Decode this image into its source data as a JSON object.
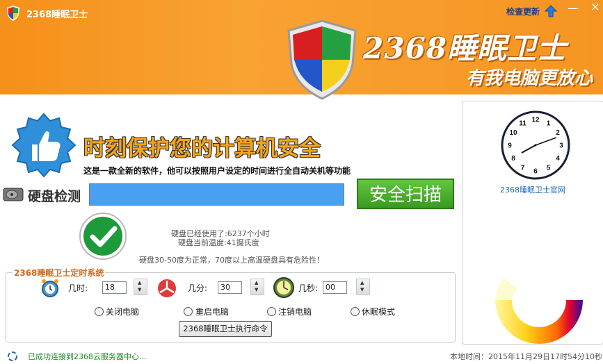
{
  "window": {
    "title": "2368睡眠卫士",
    "update_label": "检查更新",
    "close_glyph": "×",
    "minimize_glyph": "—"
  },
  "banner": {
    "brand_name": "2368睡眠卫士",
    "slogan": "有我电脑更放心"
  },
  "main": {
    "headline": "时刻保护您的计算机安全",
    "description": "这是一款全新的软件，他可以按照用户设定的时间进行全自动关机等功能"
  },
  "disk": {
    "label": "硬盘检测",
    "scan_button": "安全扫描",
    "usage_text": "硬盘已经使用了:6237个小时",
    "temp_text": "硬盘当前温度:41摄氏度",
    "warning_text": "硬盘30-50度为正常，70度以上高温硬盘具有危险性！"
  },
  "timer": {
    "legend": "2368睡眠卫士定时系统",
    "hour_label": "几时:",
    "hour_value": "18",
    "minute_label": "几分:",
    "minute_value": "30",
    "second_label": "几秒:",
    "second_value": "00",
    "options": [
      "关闭电脑",
      "重启电脑",
      "注销电脑",
      "休眠模式"
    ],
    "execute_button": "2368睡眠卫士执行命令"
  },
  "clock": {
    "numbers": [
      "12",
      "1",
      "2",
      "3",
      "4",
      "5",
      "6",
      "7",
      "8",
      "9",
      "10",
      "11"
    ],
    "official_link": "2368睡眠卫士官网"
  },
  "status": {
    "connection_text": "已成功连接到2368云服务器中心...",
    "local_time_text": "本地时间：2015年11月29日17时54分10秒"
  },
  "colors": {
    "header_orange": "#f7941d",
    "headline_orange": "#f6a41a",
    "scan_green": "#48b02c",
    "disk_bar_blue": "#4aa0f0"
  }
}
